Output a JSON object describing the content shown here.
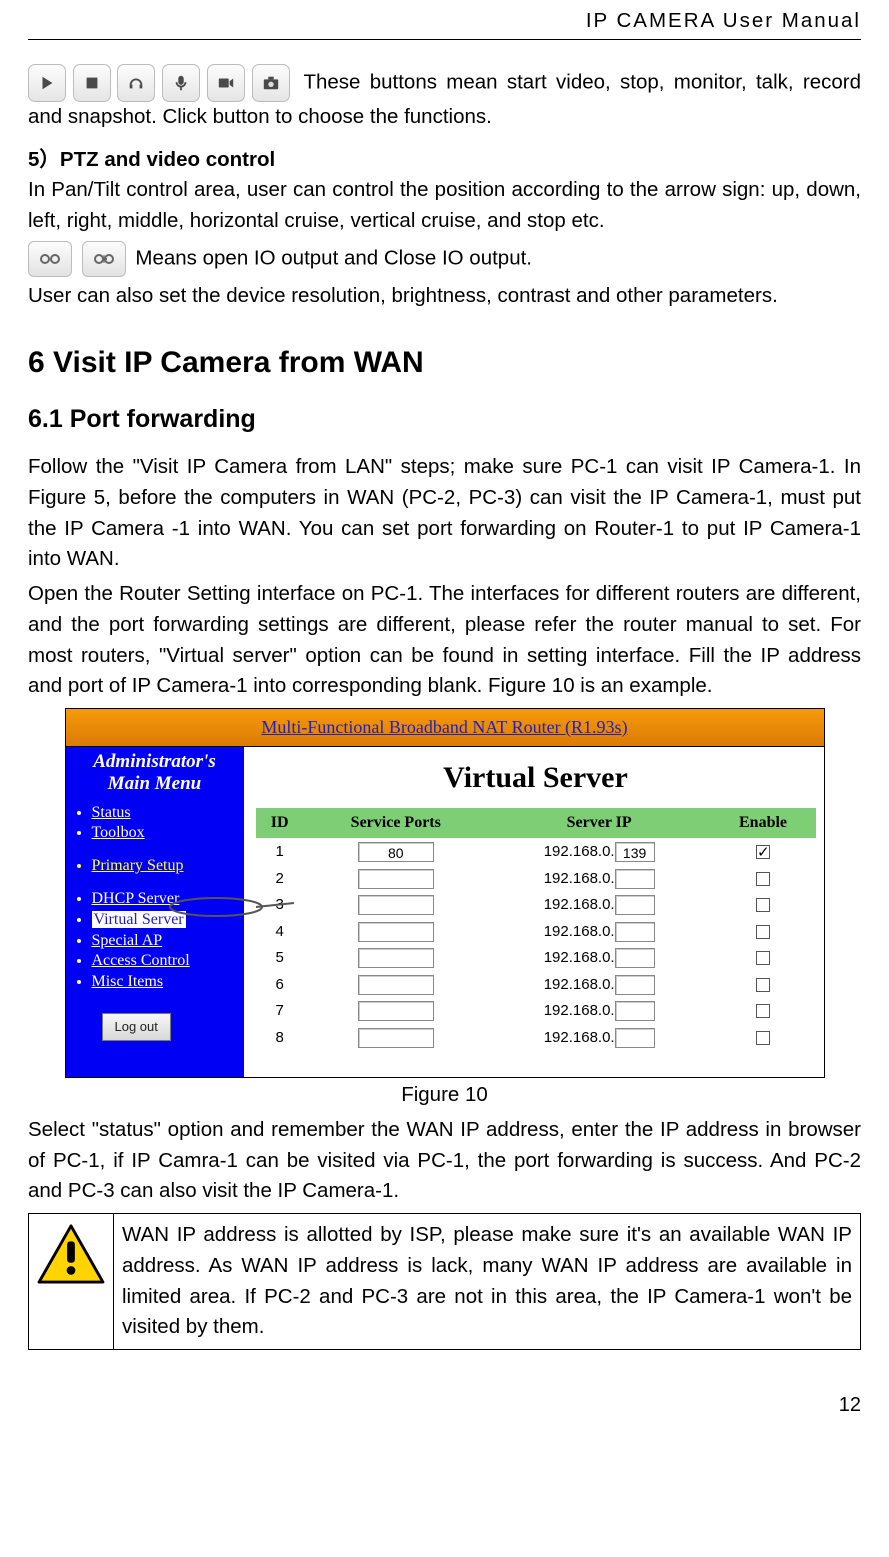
{
  "header": {
    "doc_title": "IP CAMERA User Manual"
  },
  "intro": {
    "buttons_sentence_part1": " These buttons mean start video, stop, monitor, talk, record and snapshot. Click button to choose the functions."
  },
  "section5": {
    "title": "5）PTZ and video control",
    "p1": "In Pan/Tilt control area, user can control the position according to the arrow sign: up, down, left, right, middle, horizontal cruise, vertical cruise, and stop etc.",
    "io_sentence": " Means open IO output and Close IO output.",
    "p2": "User can also set the device resolution, brightness, contrast and other parameters."
  },
  "chapter6": {
    "title": "6  Visit IP Camera from WAN"
  },
  "section61": {
    "title": "6.1  Port forwarding",
    "p1": "Follow the \"Visit IP Camera from LAN\" steps; make sure PC-1 can visit IP Camera-1. In Figure 5, before the computers in WAN (PC-2, PC-3) can visit the IP Camera-1, must put the IP Camera -1 into WAN. You can set port forwarding on Router-1 to put IP Camera-1 into WAN.",
    "p2": "Open the Router Setting interface on PC-1. The interfaces for different routers are different, and the port forwarding settings are different, please refer the router manual to set. For most routers, \"Virtual server\" option can be found in setting interface. Fill the IP address and port of IP Camera-1 into corresponding blank. Figure 10 is an example."
  },
  "router": {
    "titlebar": "Multi-Functional Broadband NAT Router (R1.93s)",
    "sidebar": {
      "menu_title_l1": "Administrator's",
      "menu_title_l2": "Main Menu",
      "items": {
        "status": "Status",
        "toolbox": "Toolbox",
        "primary_setup": "Primary Setup",
        "dhcp": "DHCP Server",
        "virtual": "Virtual Server",
        "special_ap": "Special AP",
        "access_ctrl": "Access Control",
        "misc": "Misc Items"
      },
      "logout": "Log out"
    },
    "main_heading": "Virtual Server",
    "columns": {
      "id": "ID",
      "ports": "Service Ports",
      "ip": "Server IP",
      "enable": "Enable"
    },
    "ip_prefix": "192.168.0.",
    "rows": [
      {
        "id": "1",
        "port": "80",
        "ip_suffix": "139",
        "enabled": true
      },
      {
        "id": "2",
        "port": "",
        "ip_suffix": "",
        "enabled": false
      },
      {
        "id": "3",
        "port": "",
        "ip_suffix": "",
        "enabled": false
      },
      {
        "id": "4",
        "port": "",
        "ip_suffix": "",
        "enabled": false
      },
      {
        "id": "5",
        "port": "",
        "ip_suffix": "",
        "enabled": false
      },
      {
        "id": "6",
        "port": "",
        "ip_suffix": "",
        "enabled": false
      },
      {
        "id": "7",
        "port": "",
        "ip_suffix": "",
        "enabled": false
      },
      {
        "id": "8",
        "port": "",
        "ip_suffix": "",
        "enabled": false
      }
    ]
  },
  "figure_caption": "Figure 10",
  "after_figure": {
    "p1": "Select \"status\" option and remember the WAN IP address, enter the IP address in browser of PC-1, if IP Camra-1 can be visited via PC-1, the port forwarding is success. And PC-2 and PC-3 can also visit the IP Camera-1."
  },
  "warning": {
    "text": "WAN IP address is allotted by ISP, please make sure it's an available WAN IP address. As WAN IP address is lack, many WAN IP address are available in limited area. If PC-2 and PC-3 are not in this area, the IP Camera-1 won't be visited by them."
  },
  "page_number": "12"
}
